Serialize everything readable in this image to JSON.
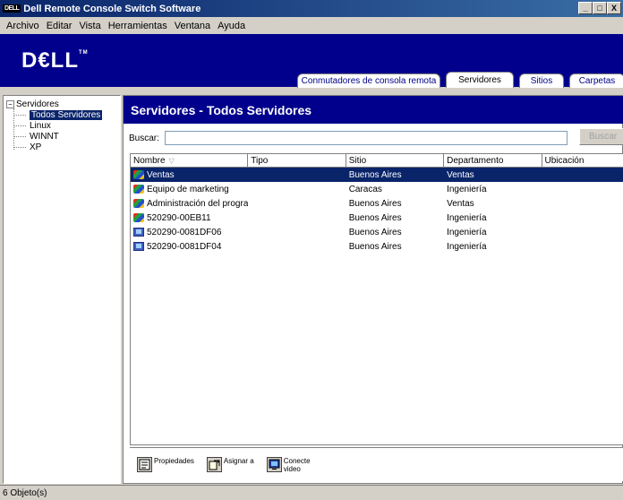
{
  "window": {
    "title": "Dell Remote Console Switch Software",
    "app_badge": "DELL",
    "min_label": "_",
    "max_label": "□",
    "close_label": "X"
  },
  "menu": [
    "Archivo",
    "Editar",
    "Vista",
    "Herramientas",
    "Ventana",
    "Ayuda"
  ],
  "brand": {
    "logo": "D€LL",
    "tm": "TM"
  },
  "tabs": [
    {
      "label": "Conmutadores de consola remota"
    },
    {
      "label": "Servidores"
    },
    {
      "label": "Sitios"
    },
    {
      "label": "Carpetas"
    }
  ],
  "tree": {
    "root": "Servidores",
    "expander": "−",
    "children": [
      "Todos Servidores",
      "Linux",
      "WINNT",
      "XP"
    ]
  },
  "main": {
    "header": "Servidores - Todos Servidores",
    "search_label": "Buscar:",
    "search_value": "",
    "search_button": "Buscar"
  },
  "table": {
    "columns": [
      "Nombre",
      "Tipo",
      "Sitio",
      "Departamento",
      "Ubicación"
    ],
    "sort_indicator": "▽",
    "rows": [
      {
        "icon": "windows-icon",
        "name": "Ventas",
        "tipo": "",
        "sitio": "Buenos Aires",
        "departamento": "Ventas",
        "ubicacion": ""
      },
      {
        "icon": "windows-icon",
        "name": "Equipo de marketing",
        "tipo": "",
        "sitio": "Caracas",
        "departamento": "Ingeniería",
        "ubicacion": ""
      },
      {
        "icon": "windows-icon",
        "name": "Administración del programa",
        "tipo": "",
        "sitio": "Buenos Aires",
        "departamento": "Ventas",
        "ubicacion": ""
      },
      {
        "icon": "windows-icon",
        "name": "520290-00EB11",
        "tipo": "",
        "sitio": "Buenos Aires",
        "departamento": "Ingeniería",
        "ubicacion": ""
      },
      {
        "icon": "computer-icon",
        "name": "520290-0081DF06",
        "tipo": "",
        "sitio": "Buenos Aires",
        "departamento": "Ingeniería",
        "ubicacion": ""
      },
      {
        "icon": "computer-icon",
        "name": "520290-0081DF04",
        "tipo": "",
        "sitio": "Buenos Aires",
        "departamento": "Ingeniería",
        "ubicacion": ""
      }
    ]
  },
  "toolbar": {
    "properties": "Propiedades",
    "assign": "Asignar a",
    "connect_line1": "Conecte",
    "connect_line2": "video"
  },
  "status": "6 Objeto(s)",
  "colors": {
    "banner": "#00008c",
    "selection": "#0a246a",
    "titlebar": "#0a246a"
  }
}
